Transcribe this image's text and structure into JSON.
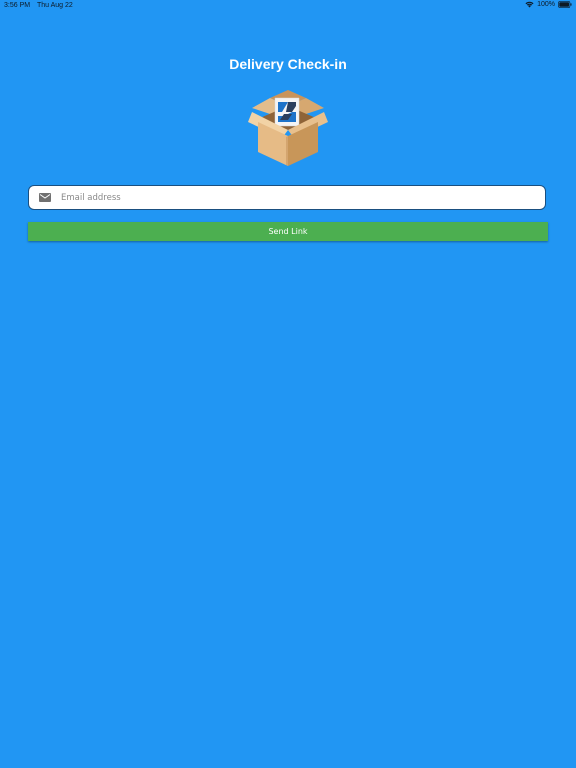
{
  "status_bar": {
    "time": "3:56 PM",
    "date": "Thu Aug 22",
    "battery": "100%"
  },
  "header": {
    "title": "Delivery Check-in"
  },
  "form": {
    "email_placeholder": "Email address",
    "email_value": "",
    "send_label": "Send Link"
  },
  "colors": {
    "background": "#2196F3",
    "button": "#4CAF50",
    "input_border": "#1a4f80"
  },
  "icons": {
    "logo": "box-logo-icon",
    "email": "mail-icon",
    "wifi": "wifi-icon",
    "battery": "battery-icon"
  }
}
